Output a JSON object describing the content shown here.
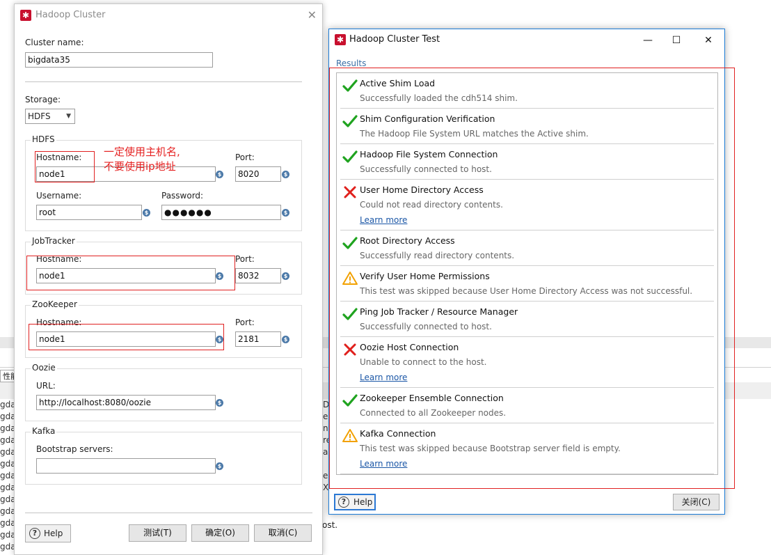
{
  "background": {
    "tab_label": "性能",
    "left_rows": [
      "gda",
      "gda",
      "gda",
      "gda",
      "gda",
      "gda",
      "gda",
      "gda",
      "gda",
      "gda",
      "gda",
      "gda",
      "gda"
    ],
    "mid_rows": [
      "D",
      "e",
      "nt",
      "re",
      "as",
      "",
      "e",
      "X",
      "",
      "",
      "",
      ""
    ],
    "host_fragment": "ost."
  },
  "cluster_window": {
    "title": "Hadoop Cluster",
    "cluster_name_label": "Cluster name:",
    "cluster_name_value": "bigdata35",
    "storage_label": "Storage:",
    "storage_value": "HDFS",
    "hdfs": {
      "group_title": "HDFS",
      "hostname_label": "Hostname:",
      "hostname_value": "node1",
      "port_label": "Port:",
      "port_value": "8020",
      "username_label": "Username:",
      "username_value": "root",
      "password_label": "Password:",
      "password_value": "●●●●●●"
    },
    "annotation_line1": "一定使用主机名,",
    "annotation_line2": "不要使用ip地址",
    "jobtracker": {
      "group_title": "JobTracker",
      "hostname_label": "Hostname:",
      "hostname_value": "node1",
      "port_label": "Port:",
      "port_value": "8032"
    },
    "zookeeper": {
      "group_title": "ZooKeeper",
      "hostname_label": "Hostname:",
      "hostname_value": "node1",
      "port_label": "Port:",
      "port_value": "2181"
    },
    "oozie": {
      "group_title": "Oozie",
      "url_label": "URL:",
      "url_value": "http://localhost:8080/oozie"
    },
    "kafka": {
      "group_title": "Kafka",
      "bootstrap_label": "Bootstrap servers:",
      "bootstrap_value": ""
    },
    "buttons": {
      "help": "Help",
      "test": "测试(T)",
      "ok": "确定(O)",
      "cancel": "取消(C)"
    },
    "variable_icon_glyph": "$"
  },
  "test_window": {
    "title": "Hadoop Cluster Test",
    "controls": {
      "minimize": "—",
      "maximize": "☐",
      "close": "✕"
    },
    "results_label": "Results",
    "results": [
      {
        "status": "success",
        "title": "Active Shim Load",
        "desc": "Successfully loaded the cdh514 shim.",
        "link": ""
      },
      {
        "status": "success",
        "title": "Shim Configuration Verification",
        "desc": "The Hadoop File System URL matches the Active shim.",
        "link": ""
      },
      {
        "status": "success",
        "title": "Hadoop File System Connection",
        "desc": "Successfully connected to host.",
        "link": ""
      },
      {
        "status": "error",
        "title": "User Home Directory Access",
        "desc": "Could not read directory contents.",
        "link": "Learn more"
      },
      {
        "status": "success",
        "title": "Root Directory Access",
        "desc": "Successfully read directory contents.",
        "link": ""
      },
      {
        "status": "warning",
        "title": "Verify User Home Permissions",
        "desc": "This test was skipped because User Home Directory Access was not successful.",
        "link": ""
      },
      {
        "status": "success",
        "title": "Ping Job Tracker / Resource Manager",
        "desc": "Successfully connected to host.",
        "link": ""
      },
      {
        "status": "error",
        "title": "Oozie Host Connection",
        "desc": "Unable to connect to the host.",
        "link": "Learn more"
      },
      {
        "status": "success",
        "title": "Zookeeper Ensemble Connection",
        "desc": "Connected to all Zookeeper nodes.",
        "link": ""
      },
      {
        "status": "warning",
        "title": "Kafka Connection",
        "desc": "This test was skipped because Bootstrap server field is empty.",
        "link": "Learn more"
      }
    ],
    "help_label": "Help",
    "close_label": "关闭(C)"
  },
  "colors": {
    "success": "#1fa31f",
    "error": "#e0201c",
    "warning": "#f2a100",
    "annotation": "#e52222",
    "accent": "#1b7bd6"
  }
}
